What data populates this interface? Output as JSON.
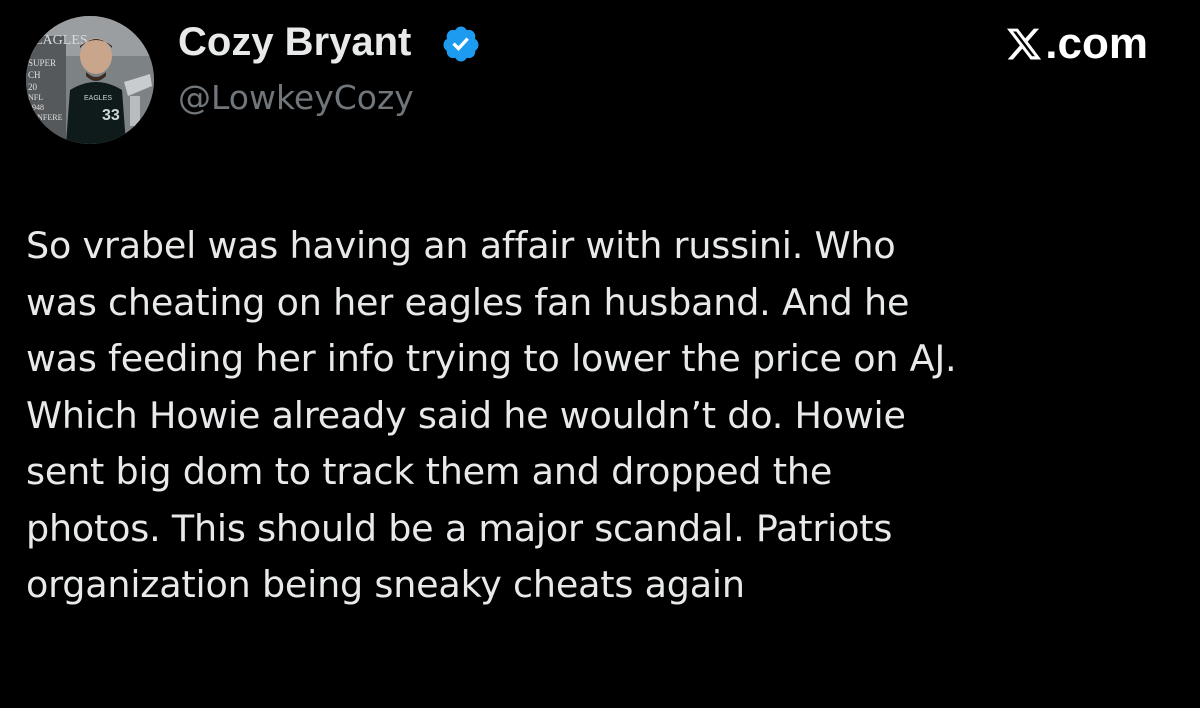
{
  "author": {
    "display_name": "Cozy Bryant",
    "handle": "@LowkeyCozy",
    "verified": true,
    "avatar_icon": "user-avatar-photo",
    "avatar_texts": [
      "EAGLES",
      "SUPER",
      "CH",
      "20",
      "NFL",
      "1948",
      "CONFERE",
      "EAGLES",
      "33"
    ]
  },
  "brand": {
    "label": ".com",
    "logo_icon": "x-logo-icon"
  },
  "tweet": {
    "text": "So vrabel was having an affair with russini. Who\nwas cheating on her eagles fan husband. And he\nwas feeding her info trying to lower the price on AJ.\nWhich Howie already said he wouldn’t do. Howie\nsent big dom to track them and dropped the\nphotos. This should be a major scandal. Patriots\norganization being sneaky cheats again"
  },
  "colors": {
    "background": "#000000",
    "primary_text": "#e7e9ea",
    "secondary_text": "#71767b",
    "verified_blue": "#1d9bf0"
  }
}
